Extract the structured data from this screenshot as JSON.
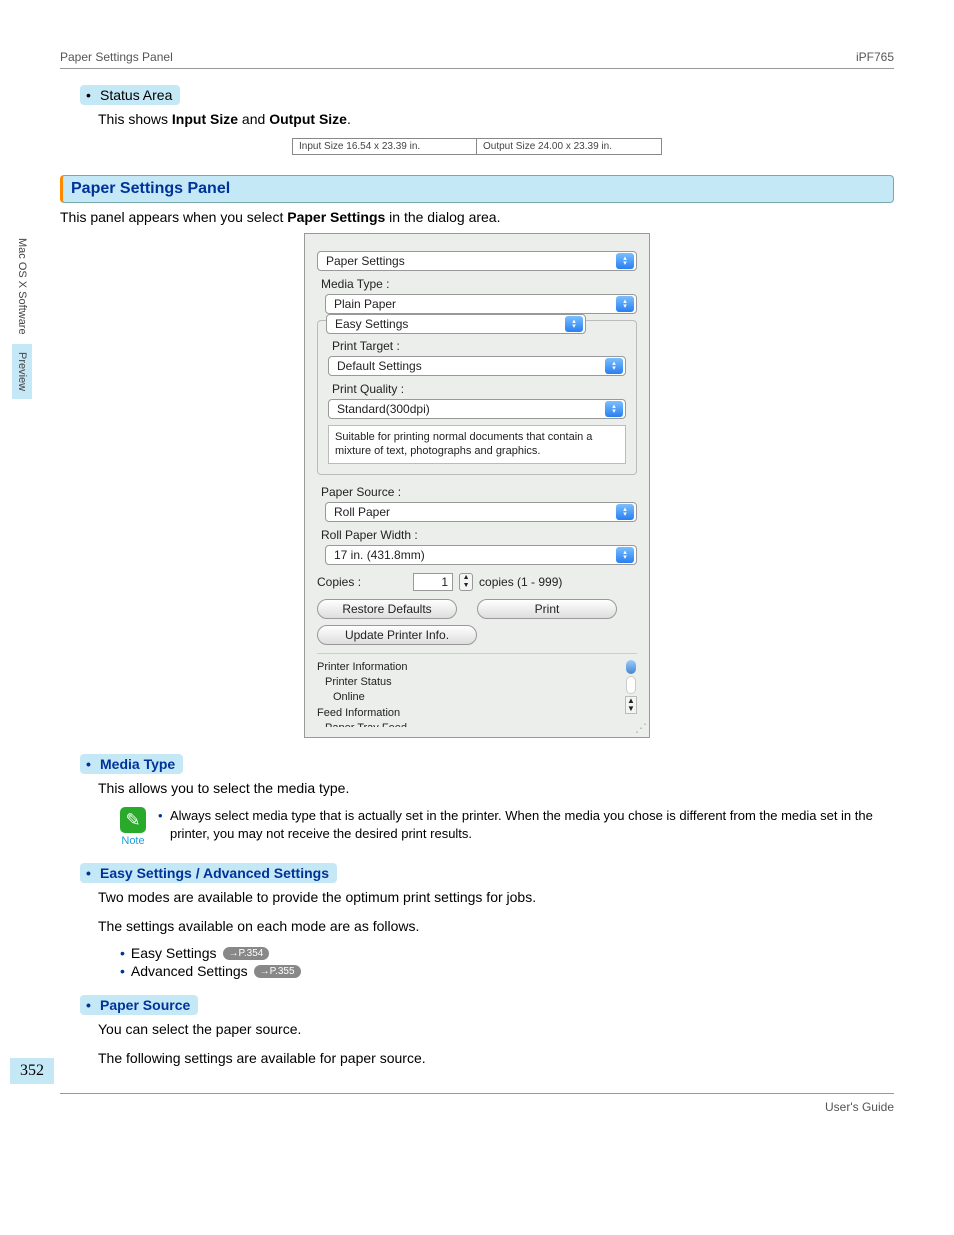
{
  "header": {
    "left": "Paper Settings Panel",
    "right": "iPF765"
  },
  "sidebar": {
    "tab1": "Mac OS X Software",
    "tab2": "Preview"
  },
  "status": {
    "title": "Status Area",
    "line_pre": "This shows ",
    "b1": "Input Size",
    "mid": " and ",
    "b2": "Output Size",
    "tail": ".",
    "input_size": "Input Size 16.54 x 23.39 in.",
    "output_size": "Output Size 24.00 x 23.39 in."
  },
  "section": {
    "title": "Paper Settings Panel",
    "intro_pre": "This panel appears when you select ",
    "intro_bold": "Paper Settings",
    "intro_post": " in the dialog area."
  },
  "dialog": {
    "panel_select": "Paper Settings",
    "media_type_label": "Media Type :",
    "media_type_value": "Plain Paper",
    "easy_settings": "Easy Settings",
    "print_target_label": "Print Target :",
    "print_target_value": "Default Settings",
    "print_quality_label": "Print Quality :",
    "print_quality_value": "Standard(300dpi)",
    "quality_desc": "Suitable for printing normal documents that contain a mixture of text, photographs and graphics.",
    "paper_source_label": "Paper Source :",
    "paper_source_value": "Roll Paper",
    "roll_width_label": "Roll Paper Width :",
    "roll_width_value": "17 in. (431.8mm)",
    "copies_label": "Copies :",
    "copies_value": "1",
    "copies_range": "copies (1 - 999)",
    "restore_defaults": "Restore Defaults",
    "print": "Print",
    "update_printer": "Update Printer Info.",
    "printer_info": "Printer Information",
    "printer_status": "Printer Status",
    "online": "Online",
    "feed_info": "Feed Information",
    "paper_tray": "Paper Tray Feed"
  },
  "media_type": {
    "title": "Media Type",
    "desc": "This allows you to select the media type.",
    "note_label": "Note",
    "note_text": "Always select media type that is actually set in the printer. When the media you chose is different from the media set in the printer, you may not receive the desired print results."
  },
  "easy_adv": {
    "title": "Easy Settings / Advanced Settings",
    "desc1": "Two modes are available to provide the optimum print settings for jobs.",
    "desc2": "The settings available on each mode are as follows.",
    "item1": "Easy Settings",
    "ref1": "→P.354",
    "item2": "Advanced Settings",
    "ref2": "→P.355"
  },
  "paper_source": {
    "title": "Paper Source",
    "desc1": "You can select the paper source.",
    "desc2": "The following settings are available for paper source."
  },
  "page_number": "352",
  "footer": "User's Guide"
}
